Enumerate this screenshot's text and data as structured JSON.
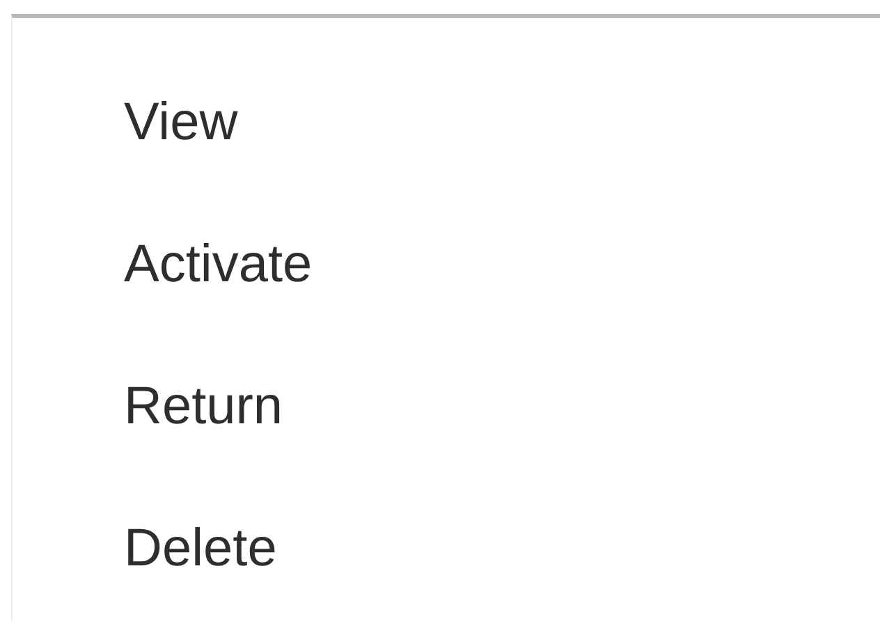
{
  "menu": {
    "items": [
      {
        "label": "View"
      },
      {
        "label": "Activate"
      },
      {
        "label": "Return"
      },
      {
        "label": "Delete"
      }
    ]
  }
}
